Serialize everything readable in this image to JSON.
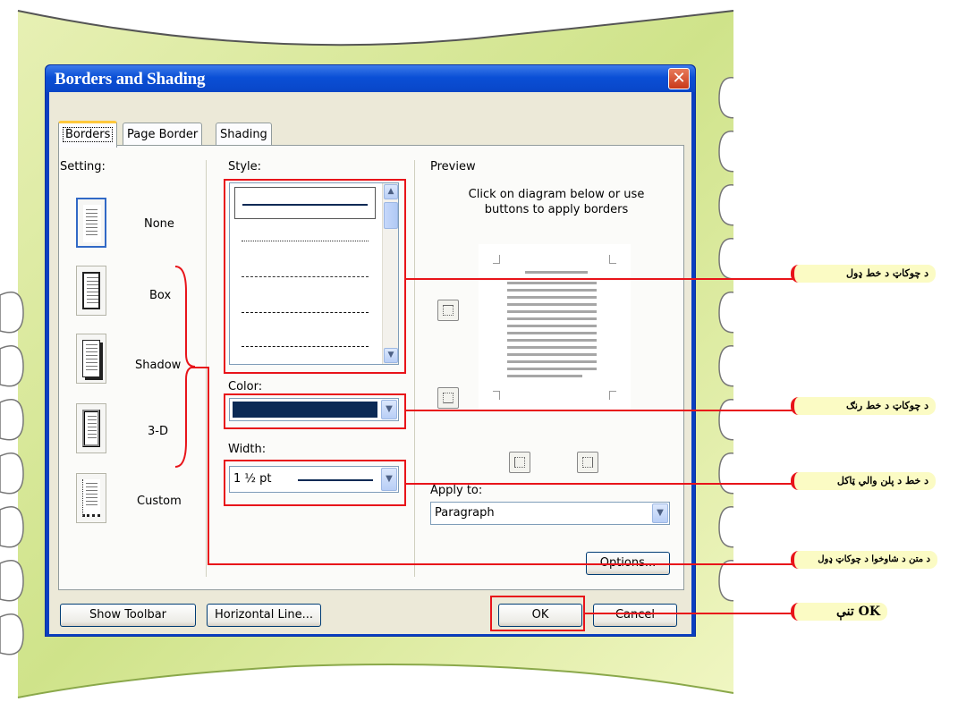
{
  "colors": {
    "title_blue": "#0a4fd6",
    "highlight_red": "#e8141a",
    "frame_green": "#cfe38a",
    "callout_bg": "#fbfbc4",
    "line_navy": "#0c2a55"
  },
  "dialog": {
    "title": "Borders and Shading",
    "close_glyph": "✕"
  },
  "tabs": [
    {
      "label": "Borders",
      "active": true
    },
    {
      "label": "Page Border",
      "active": false
    },
    {
      "label": "Shading",
      "active": false
    }
  ],
  "setting": {
    "heading": "Setting:",
    "options": [
      {
        "label": "None",
        "icon": "none-setting-icon"
      },
      {
        "label": "Box",
        "icon": "box-setting-icon"
      },
      {
        "label": "Shadow",
        "icon": "shadow-setting-icon"
      },
      {
        "label": "3-D",
        "icon": "3d-setting-icon"
      },
      {
        "label": "Custom",
        "icon": "custom-setting-icon"
      }
    ]
  },
  "style": {
    "label": "Style:",
    "options": [
      "solid",
      "dotted",
      "dashed",
      "long-dash",
      "dash-dot"
    ]
  },
  "color": {
    "label": "Color:",
    "value": "#0c2a55"
  },
  "width": {
    "label": "Width:",
    "value": "1 ½ pt"
  },
  "preview": {
    "label": "Preview",
    "hint": "Click on diagram below or use buttons to apply borders"
  },
  "apply_to": {
    "label": "Apply to:",
    "value": "Paragraph"
  },
  "buttons": {
    "options": "Options...",
    "show_toolbar": "Show Toolbar",
    "horizontal_line": "Horizontal Line...",
    "ok": "OK",
    "cancel": "Cancel"
  },
  "callouts": [
    "د چوکاټ د خط ډول",
    "د چوکاټ د خط رنګ",
    "د خط د پلن والي ټاکل",
    "د متن د شاوخوا د چوکاټ ډول",
    "OK تنې"
  ]
}
